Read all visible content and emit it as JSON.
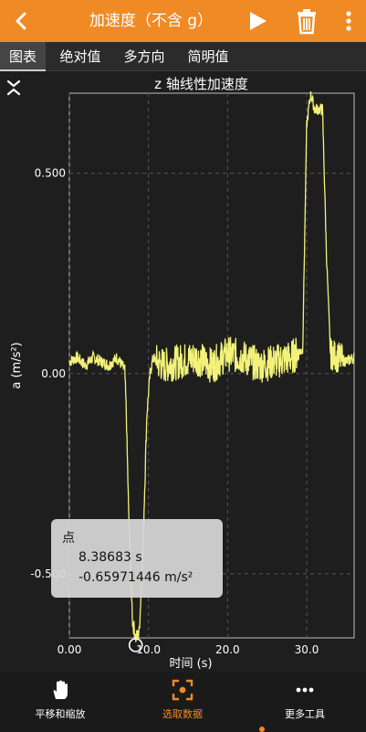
{
  "colors": {
    "accent": "#f08a24",
    "trace": "#f2f27a",
    "background": "#1e1e1e"
  },
  "header": {
    "title": "加速度（不含 g）",
    "icons": [
      "back-icon",
      "play-icon",
      "trash-icon",
      "more-vertical-icon"
    ]
  },
  "tabs": [
    {
      "label": "图表",
      "active": true
    },
    {
      "label": "绝对值",
      "active": false
    },
    {
      "label": "多方向",
      "active": false
    },
    {
      "label": "简明值",
      "active": false
    }
  ],
  "chart_data": {
    "type": "line",
    "title": "z 轴线性加速度",
    "xlabel": "时间 (s)",
    "ylabel": "a (m/s²)",
    "xlim": [
      0,
      36
    ],
    "ylim": [
      -0.66,
      0.7
    ],
    "x_ticks": [
      "0.00",
      "10.0",
      "20.0",
      "30.0"
    ],
    "x_tick_values": [
      0,
      10,
      20,
      30
    ],
    "y_ticks": [
      "0.500",
      "0.00",
      "-0.500"
    ],
    "y_tick_values": [
      0.5,
      0,
      -0.5
    ],
    "grid": true,
    "series": [
      {
        "x": [
          0,
          1,
          2,
          3,
          4,
          5,
          6,
          7,
          7.2,
          7.5,
          8,
          8.4,
          8.8,
          9.2,
          9.5,
          9.8,
          10.2,
          10.6,
          11,
          12,
          14,
          16,
          18,
          20,
          22,
          24,
          26,
          28,
          29.5,
          30,
          30.5,
          31,
          32,
          32.5,
          33,
          34,
          35,
          36
        ],
        "y": [
          0.03,
          0.04,
          0.02,
          0.04,
          0.03,
          0.02,
          0.04,
          0.01,
          -0.1,
          -0.35,
          -0.62,
          -0.66,
          -0.65,
          -0.5,
          -0.3,
          -0.1,
          0.0,
          0.04,
          0.03,
          0.02,
          0.03,
          0.04,
          0.02,
          0.05,
          0.04,
          0.02,
          0.03,
          0.04,
          0.06,
          0.62,
          0.7,
          0.66,
          0.66,
          0.3,
          0.05,
          0.04,
          0.03,
          0.04
        ]
      }
    ],
    "selected_point": {
      "x": 8.38683,
      "y": -0.65971446
    }
  },
  "tooltip": {
    "title": "点",
    "x_text": "8.38683 s",
    "y_text": "-0.65971446 m/s²"
  },
  "tools": [
    {
      "label": "平移和缩放",
      "icon": "hand-icon",
      "active": false
    },
    {
      "label": "选取数据",
      "icon": "select-data-icon",
      "active": true
    },
    {
      "label": "更多工具",
      "icon": "more-horizontal-icon",
      "active": false
    }
  ]
}
